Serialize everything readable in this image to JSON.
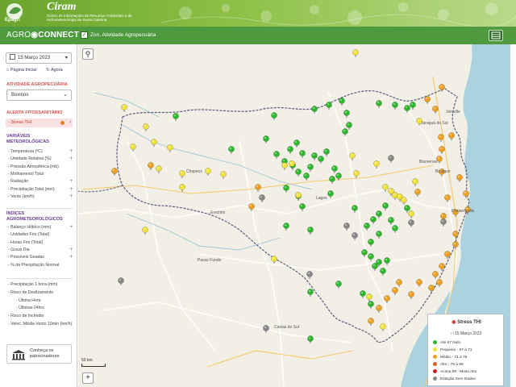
{
  "header": {
    "org": "Epagri",
    "app": "Ciram",
    "subtitle": "Centro de Informações de Recursos Ambientais e de Hidrometeorologia de Santa Catarina"
  },
  "topbar": {
    "brand_a": "AGRO",
    "brand_b": "CONNECT",
    "layer_label": "Zon. Atividade Agropecuária",
    "layer_checked": true
  },
  "sidebar": {
    "date": "15 Março 2023",
    "link_home": "Página Inicial",
    "link_now": "Agora",
    "activity_title": "ATIVIDADE AGROPECUÁRIA",
    "activity_value": "Bovinos",
    "alert_title": "ALERTA FITOSSANITÁRIO",
    "alert_item": "- Stress THI",
    "met_title": "VARIÁVEIS METEOROLÓGICAS",
    "met_items": [
      {
        "label": "- Temperatura (ºC)",
        "plus": "+"
      },
      {
        "label": "- Umidade Relativa (%)",
        "plus": "+"
      },
      {
        "label": "- Pressão Atmosférica (mb)",
        "plus": ""
      },
      {
        "label": "- Molhamento Total",
        "plus": ""
      },
      {
        "label": "- Radiação",
        "plus": "+"
      },
      {
        "label": "- Precipitação Total (mm)",
        "plus": "+"
      },
      {
        "label": "- Vento (km/h)",
        "plus": "+"
      }
    ],
    "agro_title": "ÍNDICES AGROMETEOROLÓGICOS",
    "agro_items": [
      {
        "label": "- Balanço Hídrico (mm)",
        "plus": "+"
      },
      {
        "label": "- Unidades Frio (Total)",
        "plus": ""
      },
      {
        "label": "- Horas Frio (Total)",
        "plus": ""
      },
      {
        "label": "- Graus Dia",
        "plus": "+"
      },
      {
        "label": "- Possíveis Geadas",
        "plus": "+"
      },
      {
        "label": "- % da Precipitação Normal",
        "plus": ""
      }
    ],
    "other_items": [
      "- Precipitação 1 hora (mm)",
      "- Risco de Deslizamento",
      "- Última Hora",
      "- Últimas 24hrs",
      "- Risco de Incêndio",
      "- Veloc. Média Vento 10min (km/h)"
    ],
    "sponsor_label": "Conheça os patrocinadores"
  },
  "map": {
    "scale_label": "50 km",
    "zoom_in": "+",
    "places": [
      "Joinville",
      "Jaraguá do Sul",
      "Blumenau",
      "Brusque",
      "Florianópolis",
      "Chapecó",
      "Erechim",
      "Passo Fundo",
      "Caxias do Sul",
      "Lages"
    ]
  },
  "legend": {
    "title": "Stress THI",
    "date": "15 Março 2023",
    "entries": [
      {
        "label": "Até 67 Nulo",
        "color": "#2eb82e"
      },
      {
        "label": "Pequeno - 67 à 71",
        "color": "#f2e33a"
      },
      {
        "label": "Médio - 71 à 79",
        "color": "#f0a020"
      },
      {
        "label": "Alto - 78 à 89",
        "color": "#e06020"
      },
      {
        "label": "Acima 89 - Muito Alto",
        "color": "#d02020"
      },
      {
        "label": "Estação Sem Dados",
        "color": "#888888"
      }
    ]
  },
  "colors": {
    "green": "#2eb82e",
    "yellow": "#f2e33a",
    "orange": "#f0a020",
    "darkorange": "#e06020",
    "gray": "#888888",
    "brand": "#4f9a3f"
  },
  "markers": {
    "green": [
      [
        218,
        144
      ],
      [
        287,
        185
      ],
      [
        340,
        143
      ],
      [
        330,
        172
      ],
      [
        343,
        191
      ],
      [
        353,
        200
      ],
      [
        360,
        185
      ],
      [
        368,
        177
      ],
      [
        375,
        190
      ],
      [
        363,
        205
      ],
      [
        370,
        213
      ],
      [
        380,
        218
      ],
      [
        385,
        207
      ],
      [
        390,
        193
      ],
      [
        398,
        197
      ],
      [
        405,
        188
      ],
      [
        415,
        209
      ],
      [
        420,
        218
      ],
      [
        412,
        222
      ],
      [
        355,
        233
      ],
      [
        370,
        243
      ],
      [
        375,
        256
      ],
      [
        410,
        240
      ],
      [
        390,
        135
      ],
      [
        408,
        130
      ],
      [
        424,
        125
      ],
      [
        430,
        140
      ],
      [
        433,
        155
      ],
      [
        428,
        163
      ],
      [
        470,
        128
      ],
      [
        490,
        130
      ],
      [
        505,
        134
      ],
      [
        512,
        130
      ],
      [
        440,
        258
      ],
      [
        455,
        280
      ],
      [
        463,
        272
      ],
      [
        470,
        265
      ],
      [
        478,
        255
      ],
      [
        485,
        273
      ],
      [
        490,
        283
      ],
      [
        470,
        290
      ],
      [
        460,
        300
      ],
      [
        452,
        313
      ],
      [
        460,
        318
      ],
      [
        470,
        325
      ],
      [
        480,
        323
      ],
      [
        465,
        330
      ],
      [
        475,
        336
      ],
      [
        450,
        364
      ],
      [
        460,
        377
      ],
      [
        420,
        352
      ],
      [
        385,
        362
      ],
      [
        385,
        420
      ],
      [
        355,
        280
      ],
      [
        385,
        285
      ],
      [
        505,
        258
      ]
    ],
    "yellow": [
      [
        154,
        133
      ],
      [
        181,
        157
      ],
      [
        165,
        182
      ],
      [
        191,
        176
      ],
      [
        211,
        183
      ],
      [
        197,
        209
      ],
      [
        226,
        215
      ],
      [
        226,
        232
      ],
      [
        258,
        212
      ],
      [
        277,
        216
      ],
      [
        353,
        205
      ],
      [
        362,
        203
      ],
      [
        437,
        193
      ],
      [
        442,
        215
      ],
      [
        467,
        203
      ],
      [
        478,
        232
      ],
      [
        485,
        237
      ],
      [
        490,
        242
      ],
      [
        496,
        244
      ],
      [
        501,
        248
      ],
      [
        515,
        225
      ],
      [
        510,
        265
      ],
      [
        441,
        65
      ],
      [
        520,
        150
      ],
      [
        370,
        242
      ],
      [
        340,
        321
      ],
      [
        180,
        285
      ],
      [
        458,
        368
      ],
      [
        475,
        405
      ]
    ],
    "orange": [
      [
        187,
        205
      ],
      [
        142,
        212
      ],
      [
        320,
        232
      ],
      [
        312,
        256
      ],
      [
        548,
        108
      ],
      [
        530,
        123
      ],
      [
        540,
        135
      ],
      [
        547,
        170
      ],
      [
        548,
        185
      ],
      [
        560,
        168
      ],
      [
        545,
        197
      ],
      [
        548,
        213
      ],
      [
        570,
        220
      ],
      [
        555,
        245
      ],
      [
        578,
        240
      ],
      [
        580,
        260
      ],
      [
        565,
        263
      ],
      [
        550,
        268
      ],
      [
        565,
        290
      ],
      [
        565,
        303
      ],
      [
        555,
        315
      ],
      [
        548,
        330
      ],
      [
        540,
        340
      ],
      [
        520,
        350
      ],
      [
        510,
        365
      ],
      [
        495,
        350
      ],
      [
        490,
        360
      ],
      [
        480,
        370
      ],
      [
        470,
        382
      ],
      [
        460,
        398
      ],
      [
        545,
        350
      ],
      [
        535,
        357
      ],
      [
        518,
        238
      ]
    ],
    "gray": [
      [
        485,
        196
      ],
      [
        325,
        245
      ],
      [
        430,
        280
      ],
      [
        440,
        292
      ],
      [
        150,
        348
      ],
      [
        330,
        407
      ],
      [
        510,
        276
      ],
      [
        384,
        340
      ],
      [
        550,
        275
      ]
    ]
  }
}
